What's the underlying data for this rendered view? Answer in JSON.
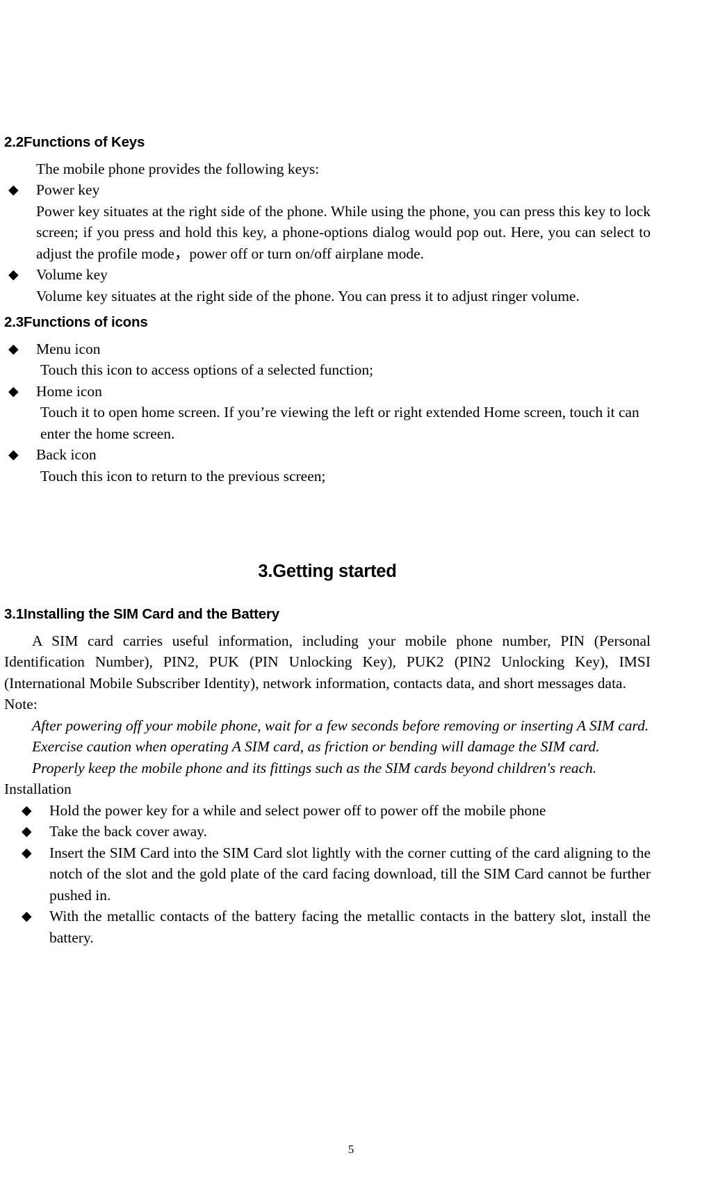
{
  "document": {
    "page_number": "5",
    "bullet_glyph": "◆"
  },
  "sections": {
    "keys": {
      "heading": "2.2Functions of Keys",
      "intro": "The mobile phone provides the following keys:",
      "items": [
        {
          "title": "Power key",
          "body": "Power key situates at the right side of the phone. While using the phone, you can press this key to lock screen; if you press and hold this key, a phone-options dialog would pop out. Here, you can select to adjust the profile mode，power off or turn on/off airplane mode."
        },
        {
          "title": "Volume key",
          "body": "Volume key situates at the right side of the phone. You can press it to adjust ringer volume."
        }
      ]
    },
    "icons": {
      "heading": "2.3Functions of icons",
      "items": [
        {
          "title": "Menu icon",
          "body": "Touch this icon to access options of a selected function;"
        },
        {
          "title": "Home icon",
          "body": "Touch it to open home screen. If you’re viewing the left or right extended Home screen, touch it can enter the home screen."
        },
        {
          "title": "Back icon",
          "body": "Touch this icon to return to the previous screen;"
        }
      ]
    },
    "getting_started": {
      "heading": "3.Getting started",
      "sim": {
        "heading": "3.1Installing the SIM Card and the Battery",
        "paragraph": "A SIM card carries useful information, including your mobile phone number, PIN (Personal Identification Number), PIN2, PUK (PIN Unlocking Key), PUK2 (PIN2 Unlocking Key), IMSI (International Mobile Subscriber Identity), network information, contacts data, and short messages data.",
        "note_label": "Note:",
        "notes": [
          "After powering off your mobile phone, wait for a few seconds before removing or inserting A SIM card.",
          "Exercise caution when operating A SIM card, as friction or bending will damage the SIM card.",
          "Properly keep the mobile phone and its fittings such as the SIM cards beyond children's reach."
        ],
        "installation_label": "Installation",
        "installation_steps": [
          "Hold the power key for a while and select power off to power off the mobile phone",
          "Take the back cover away.",
          "Insert the SIM Card into the SIM Card slot lightly with the corner cutting of the card aligning to the notch of the slot and the gold plate of the card facing download, till the SIM Card cannot be further pushed in.",
          "With the metallic contacts of the battery facing the metallic contacts in the battery slot, install the battery."
        ]
      }
    }
  }
}
